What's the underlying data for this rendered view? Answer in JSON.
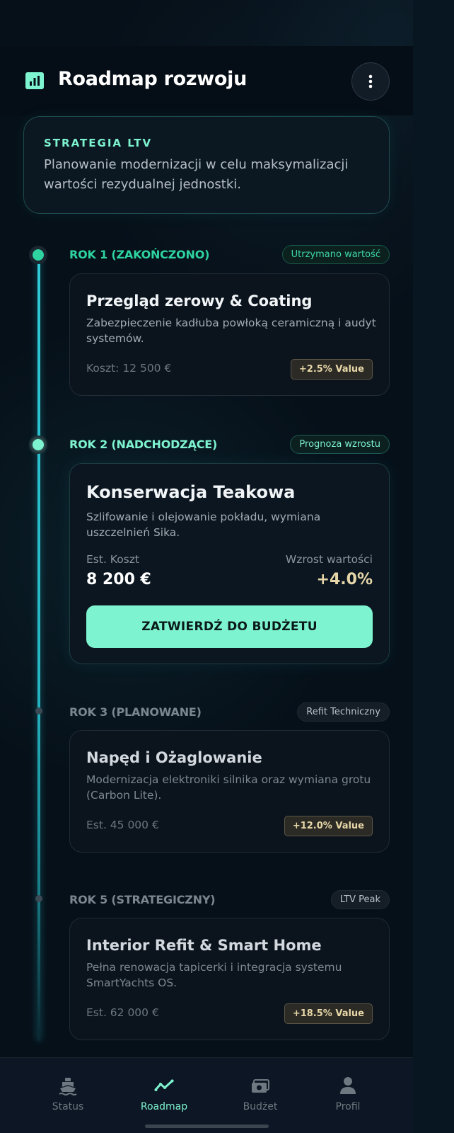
{
  "header": {
    "title": "Roadmap rozwoju"
  },
  "strategy": {
    "kicker": "STRATEGIA LTV",
    "description": "Planowanie modernizacji w celu maksymalizacji wartości rezydualnej jednostki."
  },
  "milestones": [
    {
      "year_label": "ROK 1 (ZAKOŃCZONO)",
      "tag": "Utrzymano wartość",
      "title": "Przegląd zerowy & Coating",
      "description": "Zabezpieczenie kadłuba powłoką ceramiczną i audyt systemów.",
      "cost": "Koszt: 12 500 €",
      "value_badge": "+2.5% Value"
    },
    {
      "year_label": "ROK 2 (NADCHODZĄCE)",
      "tag": "Prognoza wzrostu",
      "title": "Konserwacja Teakowa",
      "description": "Szlifowanie i olejowanie pokładu, wymiana uszczelnień Sika.",
      "cost_label": "Est. Koszt",
      "cost_value": "8 200 €",
      "growth_label": "Wzrost wartości",
      "growth_value": "+4.0%",
      "button": "ZATWIERDŹ DO BUDŻETU"
    },
    {
      "year_label": "ROK 3 (PLANOWANE)",
      "tag": "Refit Techniczny",
      "title": "Napęd i Ożaglowanie",
      "description": "Modernizacja elektroniki silnika oraz wymiana grotu (Carbon Lite).",
      "cost": "Est. 45 000 €",
      "value_badge": "+12.0% Value"
    },
    {
      "year_label": "ROK 5 (STRATEGICZNY)",
      "tag": "LTV Peak",
      "title": "Interior Refit & Smart Home",
      "description": "Pełna renowacja tapicerki i integracja systemu SmartYachts OS.",
      "cost": "Est. 62 000 €",
      "value_badge": "+18.5% Value"
    }
  ],
  "nav": {
    "items": [
      {
        "label": "Status",
        "icon": "boat-icon"
      },
      {
        "label": "Roadmap",
        "icon": "trend-line-icon"
      },
      {
        "label": "Budżet",
        "icon": "money-icon"
      },
      {
        "label": "Profil",
        "icon": "person-icon"
      }
    ],
    "active": "Roadmap"
  },
  "colors": {
    "accent": "#7ef3cf",
    "completed": "#2ed3a0",
    "gold": "#e7d7a8",
    "background": "#061019"
  }
}
